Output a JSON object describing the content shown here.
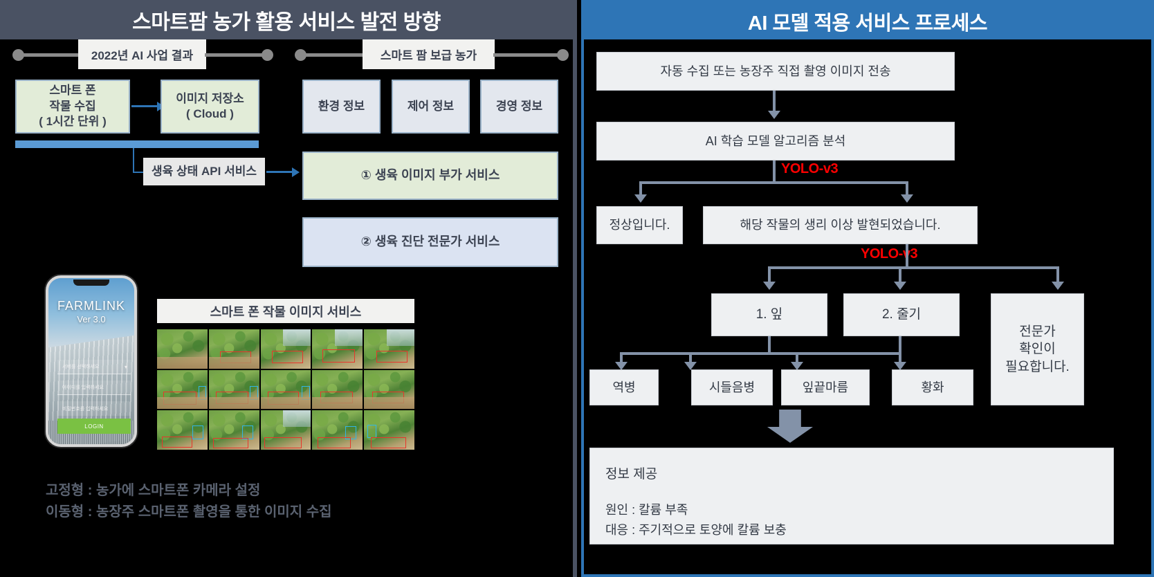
{
  "left": {
    "header_title": "스마트팜 농가 활용 서비스 발전 방향",
    "timeline": {
      "label_left": "2022년 AI 사업 결과",
      "label_right": "스마트 팜 보급 농가"
    },
    "boxes": {
      "smartphone_collect": "스마트 폰\n작물 수집\n( 1시간 단위 )",
      "smartphone_collect_l1": "스마트 폰",
      "smartphone_collect_l2": "작물 수집",
      "smartphone_collect_l3": "( 1시간 단위 )",
      "image_storage_l1": "이미지 저장소",
      "image_storage_l2": "( Cloud )",
      "api_service": "생육 상태 API 서비스",
      "env_info": "환경 정보",
      "ctrl_info": "제어 정보",
      "mgmt_info": "경영 정보",
      "service_1": "① 생육 이미지 부가 서비스",
      "service_2": "② 생육 진단 전문가 서비스"
    },
    "phone": {
      "brand": "FARMLINK",
      "version": "Ver 3.0",
      "field_server": "서버를 선택하세요",
      "field_id": "아이디를 입력하세요",
      "field_pw": "비밀번호를 입력하세요",
      "login_button": "LOGIN"
    },
    "grid_title": "스마트 폰 작물 이미지 서비스",
    "legend_line1": "고정형 : 농가에 스마트폰 카메라 설정",
    "legend_line2": "이동형 : 농장주 스마트폰 촬영을 통한 이미지 수집"
  },
  "right": {
    "header_title": "AI 모델 적용 서비스 프로세스",
    "step_input": "자동 수집 또는 농장주 직접 촬영 이미지 전송",
    "step_model": "AI 학습 모델 알고리즘 분석",
    "yolo_label_1": "YOLO-v3",
    "yolo_label_2": "YOLO-v3",
    "branch_normal": "정상입니다.",
    "branch_abnormal": "해당 작물의 생리 이상 발현되었습니다.",
    "part_1": "1. 잎",
    "part_2": "2. 줄기",
    "expert_l1": "전문가",
    "expert_l2": "확인이",
    "expert_l3": "필요합니다.",
    "disease_1": "역병",
    "disease_2": "시들음병",
    "disease_3": "잎끝마름",
    "disease_4": "황화",
    "result_title": "정보 제공",
    "result_cause": "원인 : 칼륨 부족",
    "result_action": "대응 : 주기적으로 토양에 칼륨 보충"
  },
  "colors": {
    "left_header_bg": "#4a5263",
    "right_header_bg": "#2e75b6",
    "green_box": "#e2ecd8",
    "gray_box": "#e3e7ee",
    "blue_box": "#dbe3f2",
    "accent_blue": "#5b9bd5",
    "yolo_red": "#ff0000",
    "flow_gray": "#8392a8"
  }
}
